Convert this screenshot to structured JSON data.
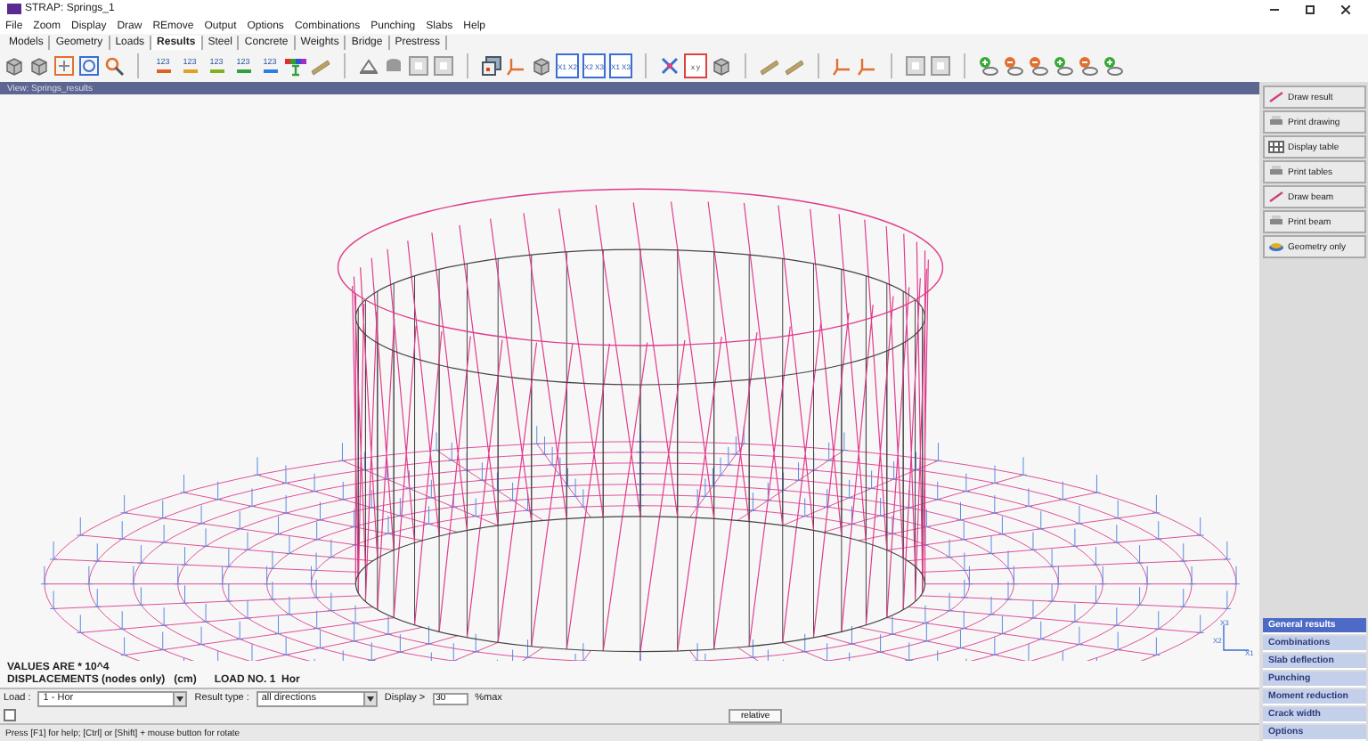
{
  "window": {
    "title": "STRAP: Springs_1"
  },
  "menu": [
    "File",
    "Zoom",
    "Display",
    "Draw",
    "REmove",
    "Output",
    "Options",
    "Combinations",
    "Punching",
    "Slabs",
    "Help"
  ],
  "tabs": [
    {
      "label": "Models",
      "selected": false
    },
    {
      "label": "Geometry",
      "selected": false
    },
    {
      "label": "Loads",
      "selected": false
    },
    {
      "label": "Results",
      "selected": true
    },
    {
      "label": "Steel",
      "selected": false
    },
    {
      "label": "Concrete",
      "selected": false
    },
    {
      "label": "Weights",
      "selected": false
    },
    {
      "label": "Bridge",
      "selected": false
    },
    {
      "label": "Prestress",
      "selected": false
    }
  ],
  "toolbar": [
    {
      "kind": "cube"
    },
    {
      "kind": "cube"
    },
    {
      "kind": "move"
    },
    {
      "kind": "refresh"
    },
    {
      "kind": "search"
    },
    {
      "kind": "sep"
    },
    {
      "kind": "number",
      "text": "123"
    },
    {
      "kind": "number",
      "text": "123"
    },
    {
      "kind": "number",
      "text": "123"
    },
    {
      "kind": "number",
      "text": "123"
    },
    {
      "kind": "number",
      "text": "123"
    },
    {
      "kind": "rainbow"
    },
    {
      "kind": "beam"
    },
    {
      "kind": "sep"
    },
    {
      "kind": "support"
    },
    {
      "kind": "stack"
    },
    {
      "kind": "frame"
    },
    {
      "kind": "frame"
    },
    {
      "kind": "sep"
    },
    {
      "kind": "windows"
    },
    {
      "kind": "axes"
    },
    {
      "kind": "cube"
    },
    {
      "kind": "xbox",
      "text": "X1 X2"
    },
    {
      "kind": "xbox",
      "text": "X2 X3"
    },
    {
      "kind": "xbox",
      "text": "X1 X3"
    },
    {
      "kind": "sep"
    },
    {
      "kind": "star"
    },
    {
      "kind": "xy",
      "text": "x y"
    },
    {
      "kind": "cube"
    },
    {
      "kind": "sep"
    },
    {
      "kind": "beam"
    },
    {
      "kind": "beam"
    },
    {
      "kind": "sep"
    },
    {
      "kind": "axes"
    },
    {
      "kind": "axes"
    },
    {
      "kind": "sep"
    },
    {
      "kind": "frame"
    },
    {
      "kind": "frame"
    },
    {
      "kind": "sep"
    },
    {
      "kind": "plus"
    },
    {
      "kind": "minus"
    },
    {
      "kind": "minus"
    },
    {
      "kind": "plus"
    },
    {
      "kind": "minus"
    },
    {
      "kind": "plus"
    }
  ],
  "view": {
    "title": "View: Springs_results"
  },
  "side_tools": [
    {
      "label": "Draw result",
      "kind": "pen"
    },
    {
      "label": "Print drawing",
      "kind": "printer"
    },
    {
      "label": "Display table",
      "kind": "table"
    },
    {
      "label": "Print tables",
      "kind": "printer"
    },
    {
      "label": "Draw beam",
      "kind": "pen"
    },
    {
      "label": "Print beam",
      "kind": "printer"
    },
    {
      "label": "Geometry only",
      "kind": "layers"
    }
  ],
  "result_info": {
    "scale": "VALUES ARE * 10^4",
    "title": "DISPLACEMENTS (nodes only)   (cm)      LOAD NO. 1  Hor"
  },
  "controls": {
    "load_label": "Load :",
    "load": "1 - Hor",
    "result_type_label": "Result type :",
    "result_type": "all directions",
    "display_label": "Display >",
    "display": "30",
    "display_unit": "%max",
    "relative_button": "relative",
    "checkbox_checked": false
  },
  "status_bar": "Press [F1] for help; [Ctrl] or [Shift] + mouse button for rotate",
  "axes": {
    "labels": [
      "X3",
      "X2",
      "X1"
    ]
  },
  "result_menu": [
    {
      "label": "General results",
      "selected": true
    },
    {
      "label": "Combinations",
      "selected": false
    },
    {
      "label": "Slab deflection",
      "selected": false
    },
    {
      "label": "Punching",
      "selected": false
    },
    {
      "label": "Moment reduction",
      "selected": false
    },
    {
      "label": "Crack width",
      "selected": false
    },
    {
      "label": "Options",
      "selected": false
    }
  ]
}
